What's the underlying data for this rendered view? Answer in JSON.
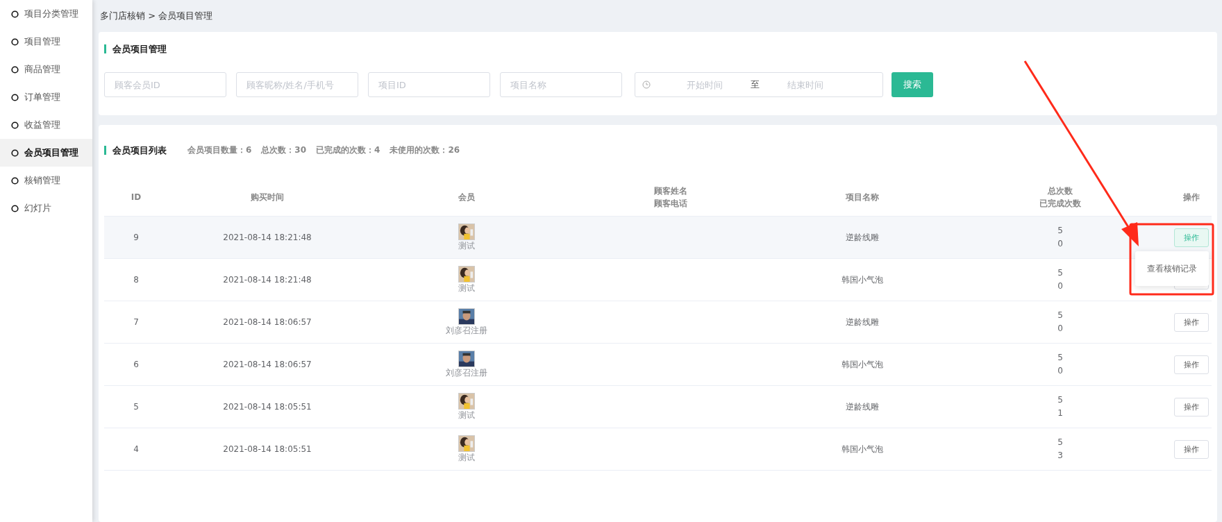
{
  "sidebar": {
    "items": [
      {
        "label": "项目分类管理",
        "selected": false
      },
      {
        "label": "项目管理",
        "selected": false
      },
      {
        "label": "商品管理",
        "selected": false
      },
      {
        "label": "订单管理",
        "selected": false
      },
      {
        "label": "收益管理",
        "selected": false
      },
      {
        "label": "会员项目管理",
        "selected": true
      },
      {
        "label": "核销管理",
        "selected": false
      },
      {
        "label": "幻灯片",
        "selected": false
      }
    ]
  },
  "breadcrumb": "多门店核销 > 会员项目管理",
  "filter_panel": {
    "title": "会员项目管理",
    "fields": [
      {
        "placeholder": "顾客会员ID"
      },
      {
        "placeholder": "顾客昵称/姓名/手机号"
      },
      {
        "placeholder": "项目ID"
      },
      {
        "placeholder": "项目名称"
      }
    ],
    "date_range": {
      "start_placeholder": "开始时间",
      "separator": "至",
      "end_placeholder": "结束时间"
    },
    "search_button": "搜索"
  },
  "list_panel": {
    "title": "会员项目列表",
    "stats": [
      "会员项目数量：6",
      "总次数：30",
      "已完成的次数：4",
      "未使用的次数：26"
    ],
    "table": {
      "columns": [
        [
          "ID"
        ],
        [
          "购买时间"
        ],
        [
          "会员"
        ],
        [
          "顾客姓名",
          "顾客电话"
        ],
        [
          "项目名称"
        ],
        [
          "总次数",
          "已完成次数"
        ],
        [
          "操作"
        ]
      ],
      "rows": [
        {
          "id": "9",
          "time": "2021-08-14 18:21:48",
          "member": "测试",
          "avatar": {
            "kind": "picture"
          },
          "project": "逆龄线雕",
          "total": "5",
          "done": "0",
          "action": "操作",
          "highlighted": true,
          "menu": [
            "查看核销记录"
          ]
        },
        {
          "id": "8",
          "time": "2021-08-14 18:21:48",
          "member": "测试",
          "avatar": {
            "kind": "picture"
          },
          "project": "韩国小气泡",
          "total": "5",
          "done": "0",
          "highlighted": false
        },
        {
          "id": "7",
          "time": "2021-08-14 18:06:57",
          "member": "刘彦召注册",
          "avatar": {
            "kind": "picture"
          },
          "project": "逆龄线雕",
          "total": "5",
          "done": "0",
          "action": "操作",
          "highlighted": false
        },
        {
          "id": "6",
          "time": "2021-08-14 18:06:57",
          "member": "刘彦召注册",
          "avatar": {
            "kind": "picture"
          },
          "project": "韩国小气泡",
          "total": "5",
          "done": "0",
          "action": "操作",
          "highlighted": false
        },
        {
          "id": "5",
          "time": "2021-08-14 18:05:51",
          "member": "测试",
          "avatar": {
            "kind": "picture"
          },
          "project": "逆龄线雕",
          "total": "5",
          "done": "1",
          "action": "操作",
          "highlighted": false
        },
        {
          "id": "4",
          "time": "2021-08-14 18:05:51",
          "member": "测试",
          "avatar": {
            "kind": "picture"
          },
          "project": "韩国小气泡",
          "total": "5",
          "done": "3",
          "action": "操作",
          "highlighted": false
        }
      ]
    }
  },
  "annotation": {
    "kind": "arrow-and-box"
  }
}
